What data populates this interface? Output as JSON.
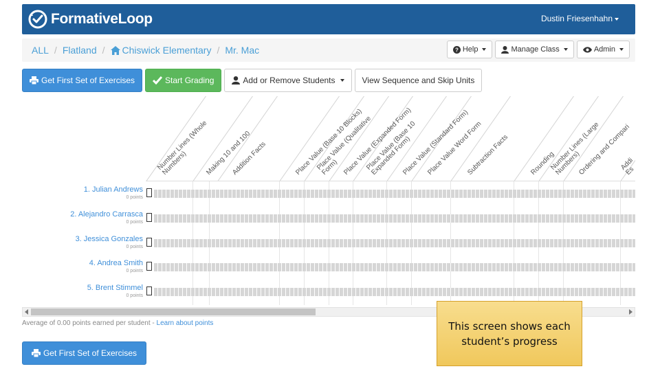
{
  "brand": {
    "logo_text": "FormativeLoop",
    "accent": "#1f5e9a"
  },
  "user_menu": {
    "name": "Dustin Friesenhahn"
  },
  "breadcrumb": [
    {
      "label": "ALL"
    },
    {
      "label": "Flatland"
    },
    {
      "label": "Chiswick Elementary",
      "icon": "home-icon"
    },
    {
      "label": "Mr. Mac"
    }
  ],
  "toolbar": {
    "help": "Help",
    "manage_class": "Manage Class",
    "admin": "Admin"
  },
  "actions": {
    "get_exercises": "Get First Set of Exercises",
    "start_grading": "Start Grading",
    "add_remove_students": "Add or Remove Students",
    "view_sequence": "View Sequence and Skip Units"
  },
  "columns": [
    "Number Lines (Whole\nNumbers)",
    "Making 10 and 100",
    "Addition Facts",
    "Place Value (Base 10 Blocks)",
    "Place Value (Qualitative\nForm)",
    "Place Value (Expanded Form)",
    "Place Value (Base 10\nExpanded Form)",
    "Place Value (Standard Form)",
    "Place Value Word Form",
    "Subtraction Facts",
    "Rounding",
    "Number Lines (Large\nNumbers)",
    "Ordering and Compari",
    "Addi\nEs"
  ],
  "students": [
    {
      "name": "1. Julian Andrews",
      "points": "0 points"
    },
    {
      "name": "2. Alejandro Carrasca",
      "points": "0 points"
    },
    {
      "name": "3. Jessica Gonzales",
      "points": "0 points"
    },
    {
      "name": "4. Andrea Smith",
      "points": "0 points"
    },
    {
      "name": "5. Brent Stimmel",
      "points": "0 points"
    }
  ],
  "footer": {
    "average_text": "Average of 0.00 points earned per student - ",
    "learn_link": "Learn about points",
    "get_exercises_bottom": "Get First Set of Exercises"
  },
  "callout": {
    "text": "This screen shows each student’s progress"
  }
}
